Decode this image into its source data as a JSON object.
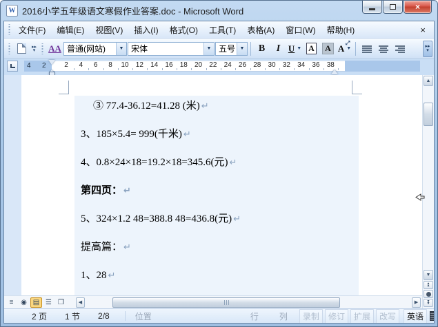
{
  "window": {
    "title": "2016小学五年级语文寒假作业答案.doc - Microsoft Word",
    "app_icon_letter": "W"
  },
  "menubar": {
    "items": [
      "文件(F)",
      "编辑(E)",
      "视图(V)",
      "插入(I)",
      "格式(O)",
      "工具(T)",
      "表格(A)",
      "窗口(W)",
      "帮助(H)"
    ],
    "close_label": "×"
  },
  "toolbar": {
    "style_combo": "普通(网站)",
    "font_combo": "宋体",
    "size_combo": "五号",
    "bold_label": "B",
    "italic_label": "I",
    "underline_label": "U",
    "char_border_label": "A",
    "char_shading_label": "A",
    "char_scale_label": "A",
    "styles_pane_label": "AA"
  },
  "ruler": {
    "margin_numbers": [
      "4",
      "2"
    ],
    "numbers": [
      "2",
      "4",
      "6",
      "8",
      "10",
      "12",
      "14",
      "16",
      "18",
      "20",
      "22",
      "24",
      "26",
      "28",
      "30",
      "32",
      "34",
      "36",
      "38"
    ]
  },
  "document": {
    "paragraph_mark": "↵",
    "paragraphs": [
      {
        "text": "③ 77.4-36.12=41.28 (米)",
        "bold": false,
        "indent": true
      },
      {
        "text": "3、185×5.4= 999(千米)",
        "bold": false,
        "indent": false
      },
      {
        "text": "4、0.8×24×18=19.2×18=345.6(元)",
        "bold": false,
        "indent": false
      },
      {
        "text": "第四页：",
        "bold": true,
        "indent": false
      },
      {
        "text": "5、324×1.2 48=388.8 48=436.8(元)",
        "bold": false,
        "indent": false
      },
      {
        "text": "提高篇：",
        "bold": false,
        "indent": false
      },
      {
        "text": "1、28",
        "bold": false,
        "indent": false
      }
    ]
  },
  "view_buttons": [
    {
      "name": "normal-view",
      "glyph": "≡",
      "active": false
    },
    {
      "name": "web-layout-view",
      "glyph": "◉",
      "active": false
    },
    {
      "name": "print-layout-view",
      "glyph": "▤",
      "active": true
    },
    {
      "name": "outline-view",
      "glyph": "☰",
      "active": false
    },
    {
      "name": "reading-layout-view",
      "glyph": "❒",
      "active": false
    }
  ],
  "statusbar": {
    "page": "2 页",
    "section": "1 节",
    "page_of": "2/8",
    "position_label": "位置",
    "line_label": "行",
    "column_label": "列",
    "indicators": [
      "录制",
      "修订",
      "扩展",
      "改写"
    ],
    "language": "英语"
  },
  "colors": {
    "titlebar": "#a9c8e8",
    "close_button": "#c2412f",
    "toolbar_bg": "#cfe1f6",
    "doc_surround": "#d9e7f8",
    "page": "#ffffff",
    "content_band": "#edf4fc",
    "active_view_highlight": "#fbd77f"
  }
}
